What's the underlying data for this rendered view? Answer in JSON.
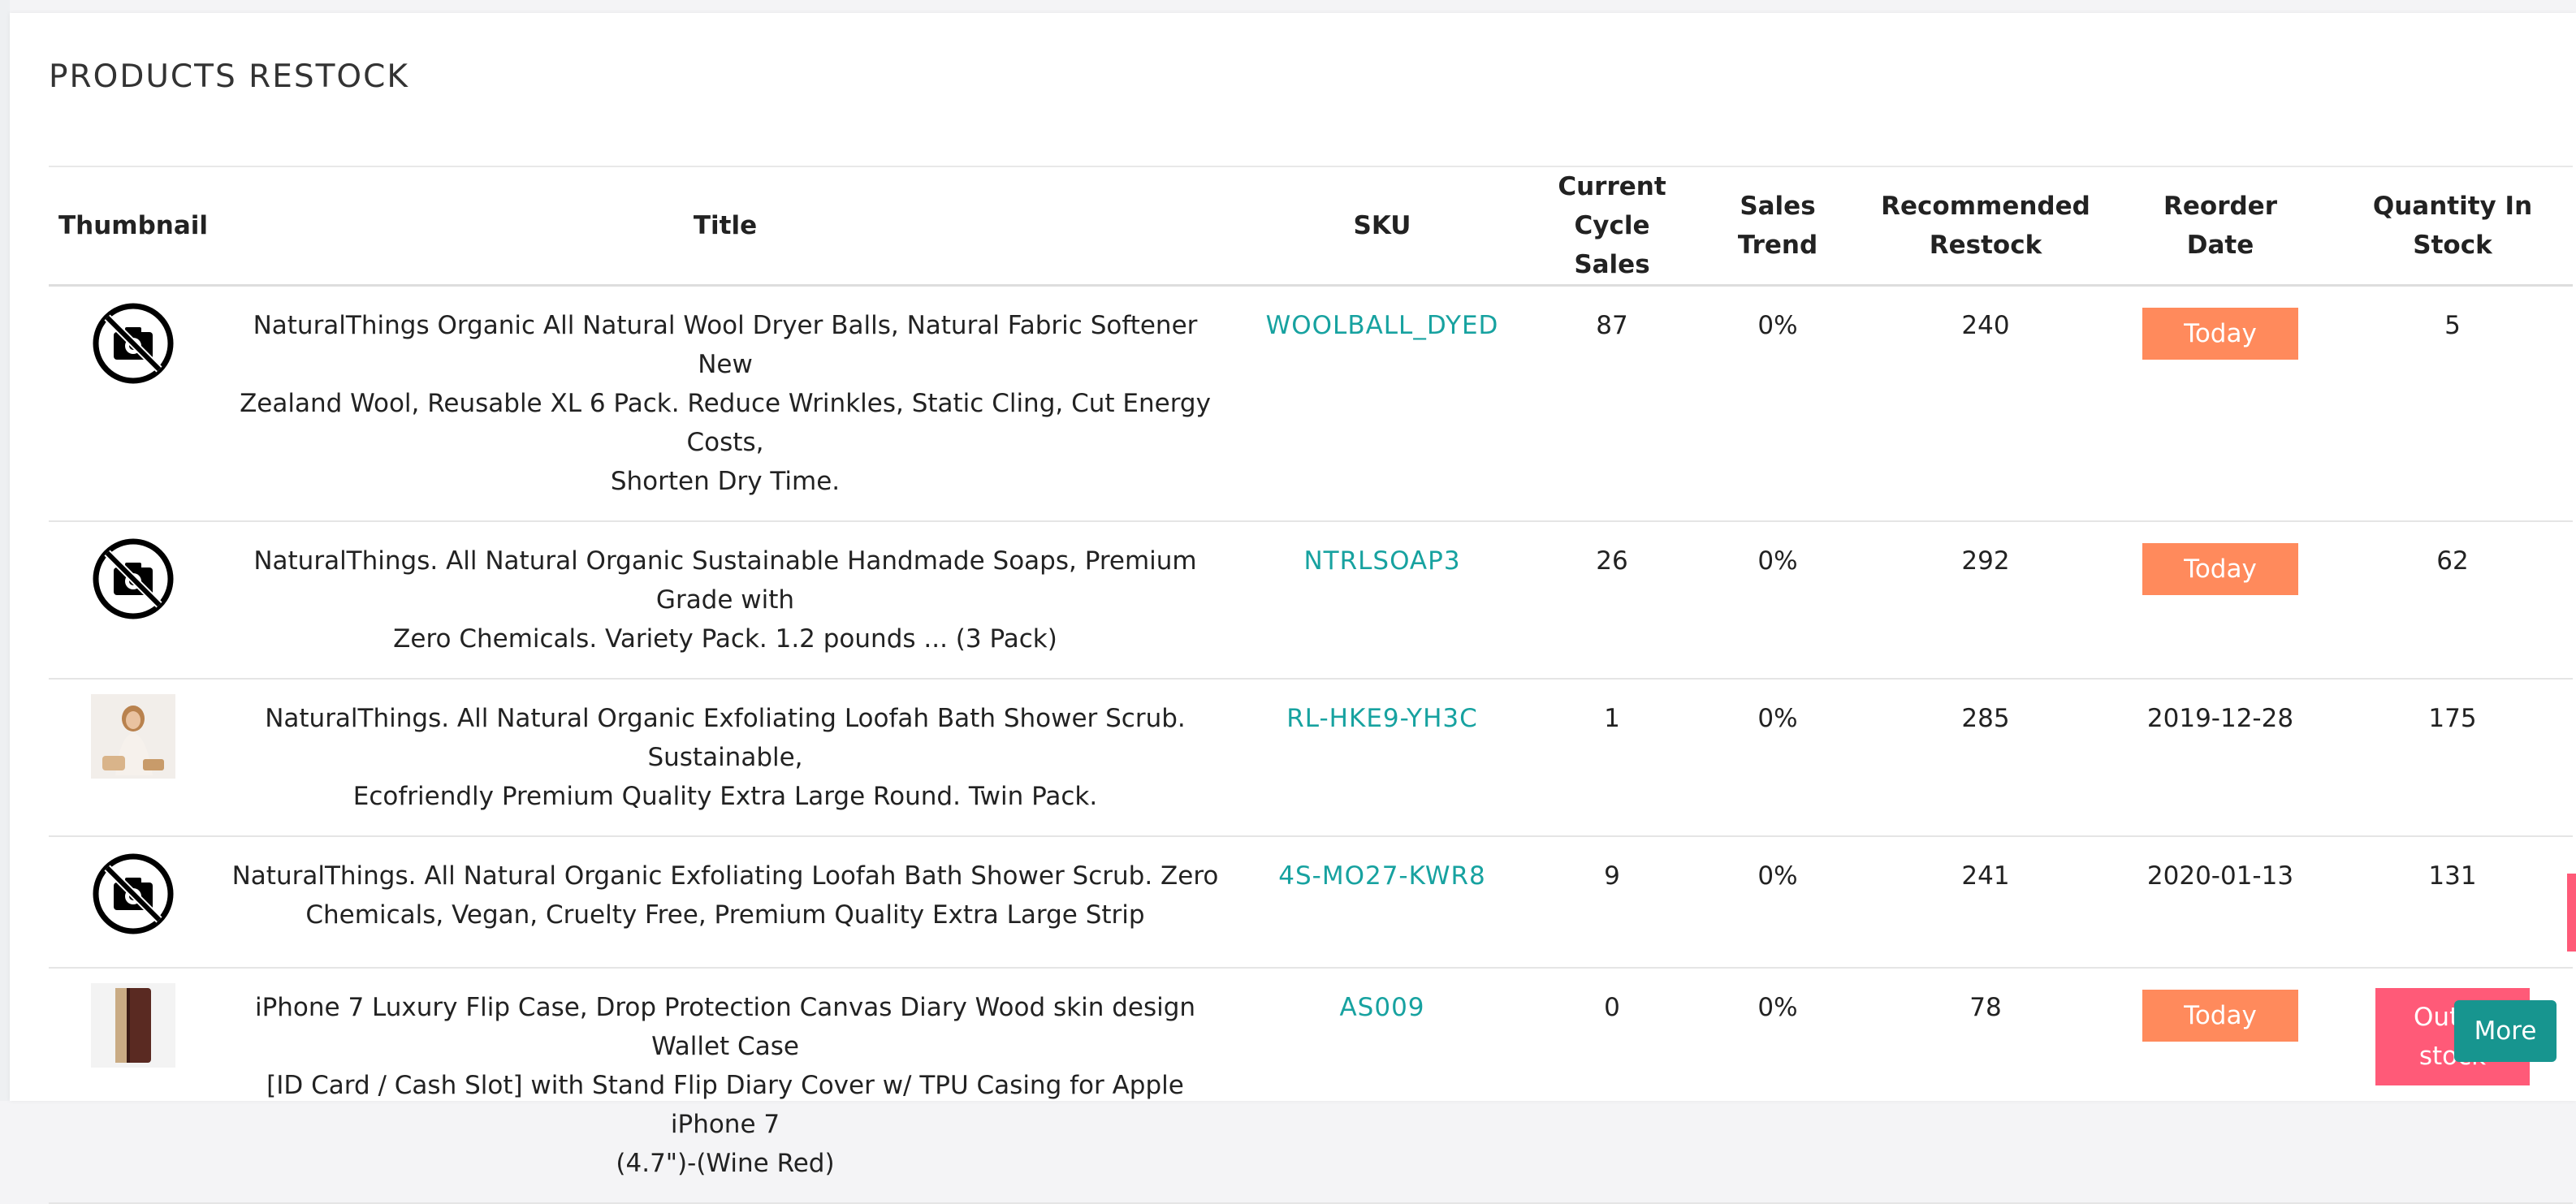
{
  "page_title": "PRODUCTS RESTOCK",
  "columns": {
    "thumbnail": "Thumbnail",
    "title": "Title",
    "sku": "SKU",
    "current_cycle_sales_l1": "Current",
    "current_cycle_sales_l2": "Cycle Sales",
    "sales_trend_l1": "Sales",
    "sales_trend_l2": "Trend",
    "recommended_restock_l1": "Recommended",
    "recommended_restock_l2": "Restock",
    "reorder_date_l1": "Reorder",
    "reorder_date_l2": "Date",
    "quantity_in_stock_l1": "Quantity In",
    "quantity_in_stock_l2": "Stock"
  },
  "rows": [
    {
      "thumbnail": "no-image-icon",
      "title_lines": [
        "NaturalThings Organic All Natural Wool Dryer Balls, Natural Fabric Softener New",
        "Zealand Wool, Reusable XL 6 Pack. Reduce Wrinkles, Static Cling, Cut Energy Costs,",
        "Shorten Dry Time."
      ],
      "sku": "WOOLBALL_DYED",
      "current_cycle_sales": "87",
      "sales_trend": "0%",
      "recommended_restock": "240",
      "reorder_date": "Today",
      "quantity_in_stock": "5"
    },
    {
      "thumbnail": "no-image-icon",
      "title_lines": [
        "NaturalThings. All Natural Organic Sustainable Handmade Soaps, Premium Grade with",
        "Zero Chemicals. Variety Pack. 1.2 pounds ... (3 Pack)"
      ],
      "sku": "NTRLSOAP3",
      "current_cycle_sales": "26",
      "sales_trend": "0%",
      "recommended_restock": "292",
      "reorder_date": "Today",
      "quantity_in_stock": "62"
    },
    {
      "thumbnail": "product-photo-woman-loofah",
      "title_lines": [
        "NaturalThings. All Natural Organic Exfoliating Loofah Bath Shower Scrub. Sustainable,",
        "Ecofriendly Premium Quality Extra Large Round. Twin Pack."
      ],
      "sku": "RL-HKE9-YH3C",
      "current_cycle_sales": "1",
      "sales_trend": "0%",
      "recommended_restock": "285",
      "reorder_date": "2019-12-28",
      "quantity_in_stock": "175"
    },
    {
      "thumbnail": "no-image-icon",
      "title_lines": [
        "NaturalThings. All Natural Organic Exfoliating Loofah Bath Shower Scrub. Zero",
        "Chemicals, Vegan, Cruelty Free, Premium Quality Extra Large Strip"
      ],
      "sku": "4S-MO27-KWR8",
      "current_cycle_sales": "9",
      "sales_trend": "0%",
      "recommended_restock": "241",
      "reorder_date": "2020-01-13",
      "quantity_in_stock": "131"
    },
    {
      "thumbnail": "product-photo-phone-case",
      "title_lines": [
        "iPhone 7 Luxury Flip Case, Drop Protection Canvas Diary Wood skin design Wallet Case",
        "[ID Card / Cash Slot] with Stand Flip Diary Cover w/ TPU Casing for Apple iPhone 7",
        "(4.7\")-(Wine Red)"
      ],
      "sku": "AS009",
      "current_cycle_sales": "0",
      "sales_trend": "0%",
      "recommended_restock": "78",
      "reorder_date": "Today",
      "quantity_in_stock_l1": "Out of",
      "quantity_in_stock_l2": "stock"
    }
  ],
  "more_button": "More",
  "colors": {
    "sku_link": "#17a2a0",
    "today_badge": "#ff8a5c",
    "out_of_stock_badge": "#ff5a78",
    "more_button": "#17958f"
  }
}
